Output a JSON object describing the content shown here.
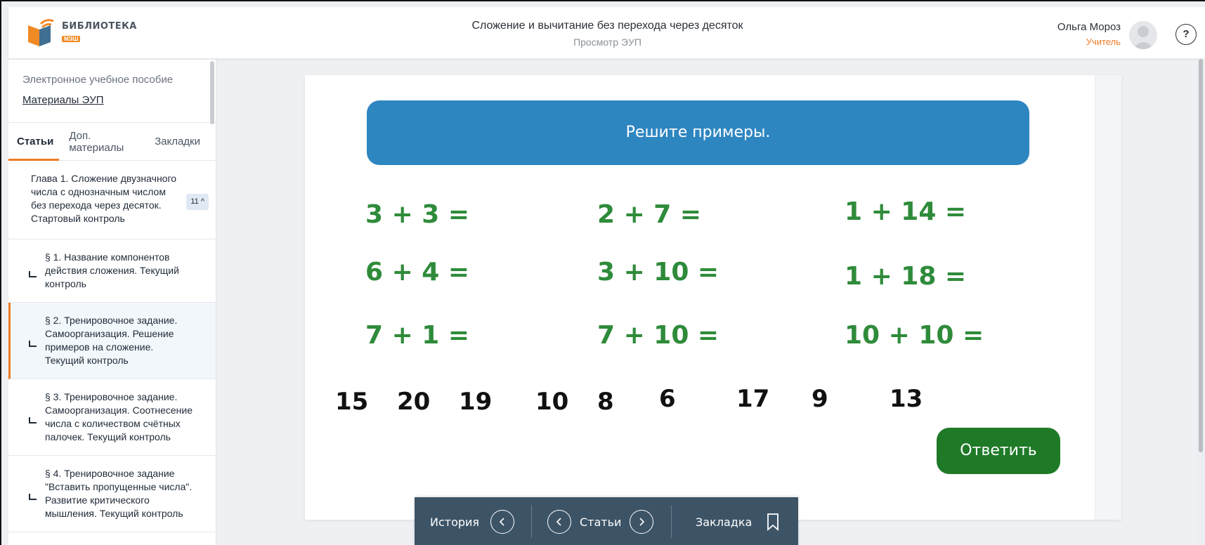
{
  "header": {
    "logo_title": "БИБЛИОТЕКА",
    "logo_sub": "МЭШ",
    "title": "Сложение и вычитание без перехода через десяток",
    "subtitle": "Просмотр ЭУП",
    "user_name": "Ольга Мороз",
    "user_role": "Учитель",
    "help_label": "?"
  },
  "sidebar": {
    "heading": "Электронное учебное пособие",
    "link": "Материалы ЭУП",
    "tabs": [
      "Статьи",
      "Доп. материалы",
      "Закладки"
    ],
    "chapter": {
      "label": "Глава 1. Сложение двузначного числа с однозначным числом без перехода через десяток. Стартовый контроль",
      "count": "11 ^"
    },
    "items": [
      "§ 1. Название компонентов действия сложения. Текущий контроль",
      "§ 2. Тренировочное задание. Самоорганизация. Решение примеров на сложение. Текущий контроль",
      "§ 3. Тренировочное задание. Самоорганизация. Соотнесение числа с количеством счётных палочек. Текущий контроль",
      "§ 4. Тренировочное задание \"Вставить пропущенные числа\". Развитие критического мышления. Текущий контроль"
    ]
  },
  "exercise": {
    "banner": "Решите примеры.",
    "expressions": [
      "3 + 3 =",
      "2 + 7 =",
      "1 + 14 =",
      "6 + 4 =",
      "3 + 10 =",
      "1 + 18 =",
      "7 + 1 =",
      "7 + 10 =",
      "10 + 10 ="
    ],
    "numbers": [
      "15",
      "20",
      "19",
      "10",
      "8",
      "6",
      "17",
      "9",
      "13"
    ],
    "answer_button": "Ответить"
  },
  "toolbar": {
    "history": "История",
    "articles": "Статьи",
    "bookmark": "Закладка"
  },
  "colors": {
    "accent": "#f07b24",
    "banner": "#2e86c1",
    "expression": "#2e8b3a",
    "answer_button": "#1f7a28",
    "toolbar": "#3d5467"
  }
}
